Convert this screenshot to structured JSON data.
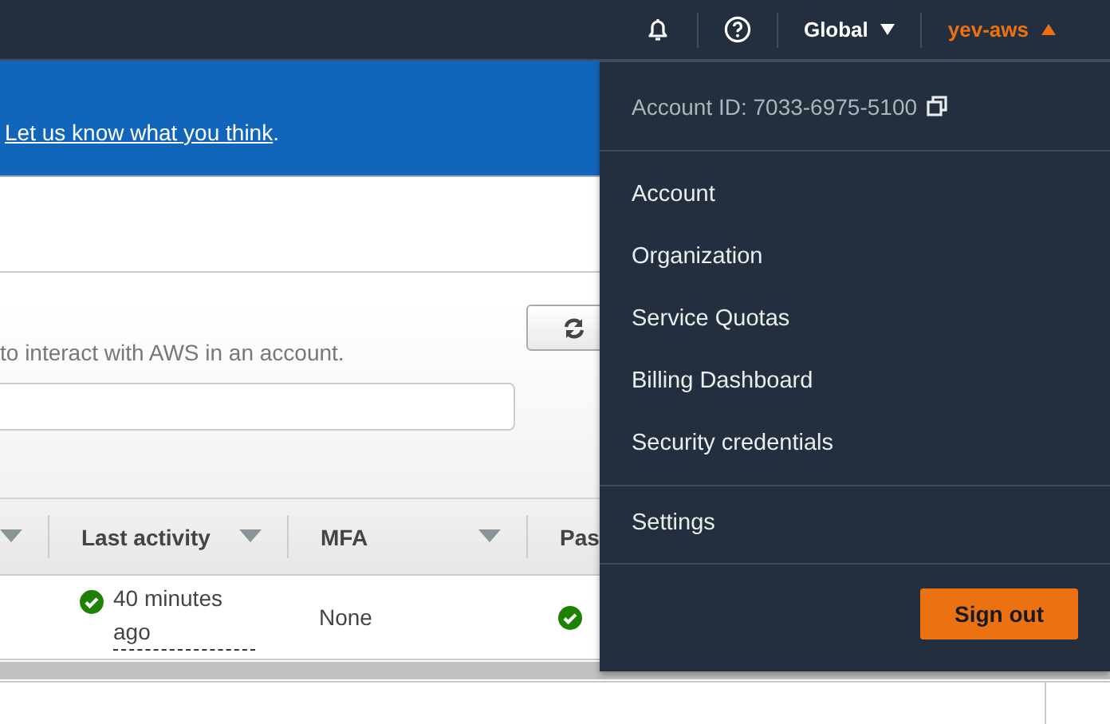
{
  "top_nav": {
    "region": "Global",
    "user": "yev-aws",
    "user_menu_expanded": true
  },
  "banner": {
    "link": "Let us know what you think",
    "trailing": "."
  },
  "panel": {
    "description": "to interact with AWS in an account."
  },
  "table": {
    "columns": [
      {
        "label": "Last activity",
        "sortable": true
      },
      {
        "label": "MFA",
        "sortable": true
      },
      {
        "label": "Pas",
        "sortable": false
      }
    ],
    "rows": [
      {
        "cells": [
          {
            "kind": "status",
            "ok": true,
            "text": "40 minutes ago"
          },
          {
            "kind": "text",
            "text": "None"
          },
          {
            "kind": "status",
            "ok": true
          }
        ]
      }
    ]
  },
  "account_menu": {
    "account_id": "Account ID: 7033-6975-5100",
    "groups": [
      [
        "Account",
        "Organization",
        "Service Quotas",
        "Billing Dashboard",
        "Security credentials"
      ],
      [
        "Settings"
      ]
    ],
    "sign_out": "Sign out"
  }
}
